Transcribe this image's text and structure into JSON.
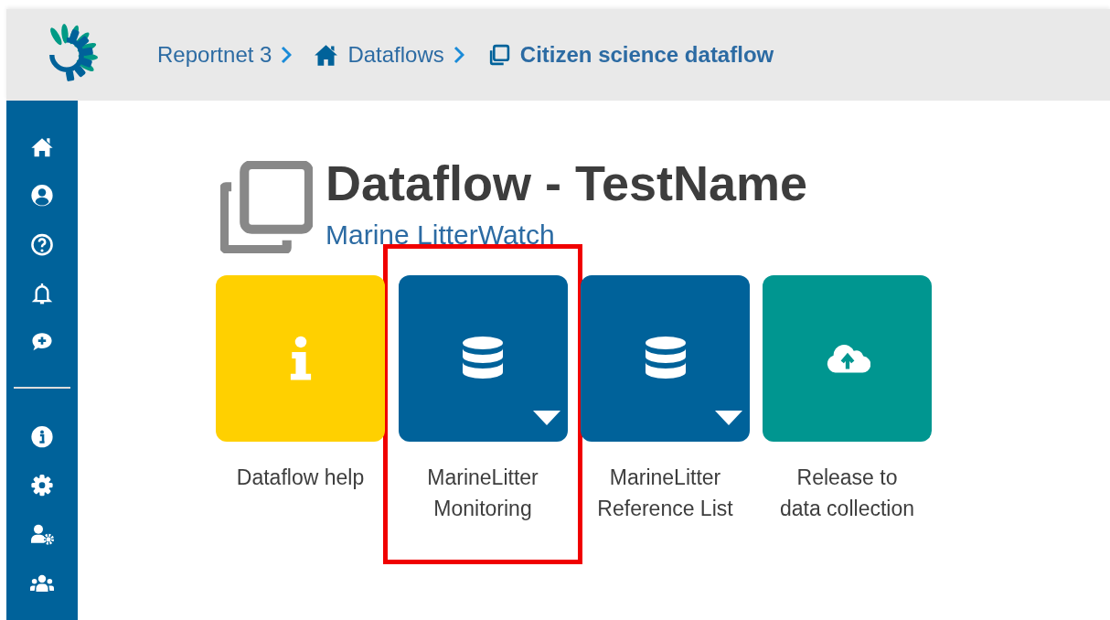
{
  "breadcrumbs": [
    {
      "label": "Reportnet 3",
      "selected": false
    },
    {
      "label": "Dataflows",
      "selected": false
    },
    {
      "label": "Citizen science dataflow",
      "selected": true
    }
  ],
  "title": "Dataflow - TestName",
  "subtitle": "Marine LitterWatch",
  "cards": [
    {
      "label": "Dataflow help",
      "kind": "help",
      "highlighted": false
    },
    {
      "label": "MarineLitter Monitoring",
      "kind": "dataset",
      "highlighted": true
    },
    {
      "label": "MarineLitter Reference List",
      "kind": "dataset",
      "highlighted": false
    },
    {
      "label": "Release to data collection",
      "kind": "release",
      "highlighted": false
    }
  ]
}
